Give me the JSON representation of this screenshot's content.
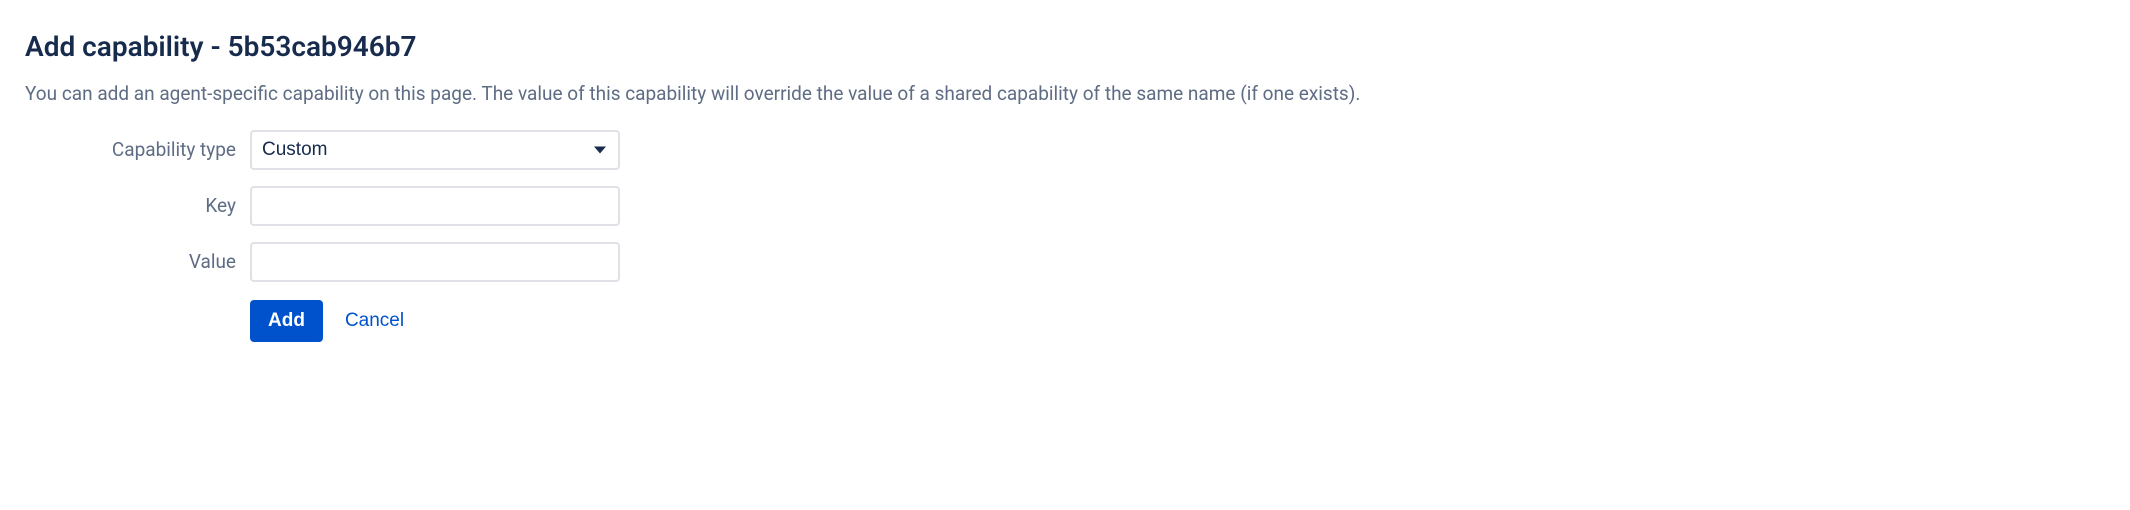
{
  "header": {
    "title": "Add capability - 5b53cab946b7",
    "description": "You can add an agent-specific capability on this page. The value of this capability will override the value of a shared capability of the same name (if one exists)."
  },
  "form": {
    "capability_type": {
      "label": "Capability type",
      "selected": "Custom"
    },
    "key": {
      "label": "Key",
      "value": ""
    },
    "value": {
      "label": "Value",
      "value": ""
    }
  },
  "actions": {
    "add_label": "Add",
    "cancel_label": "Cancel"
  }
}
